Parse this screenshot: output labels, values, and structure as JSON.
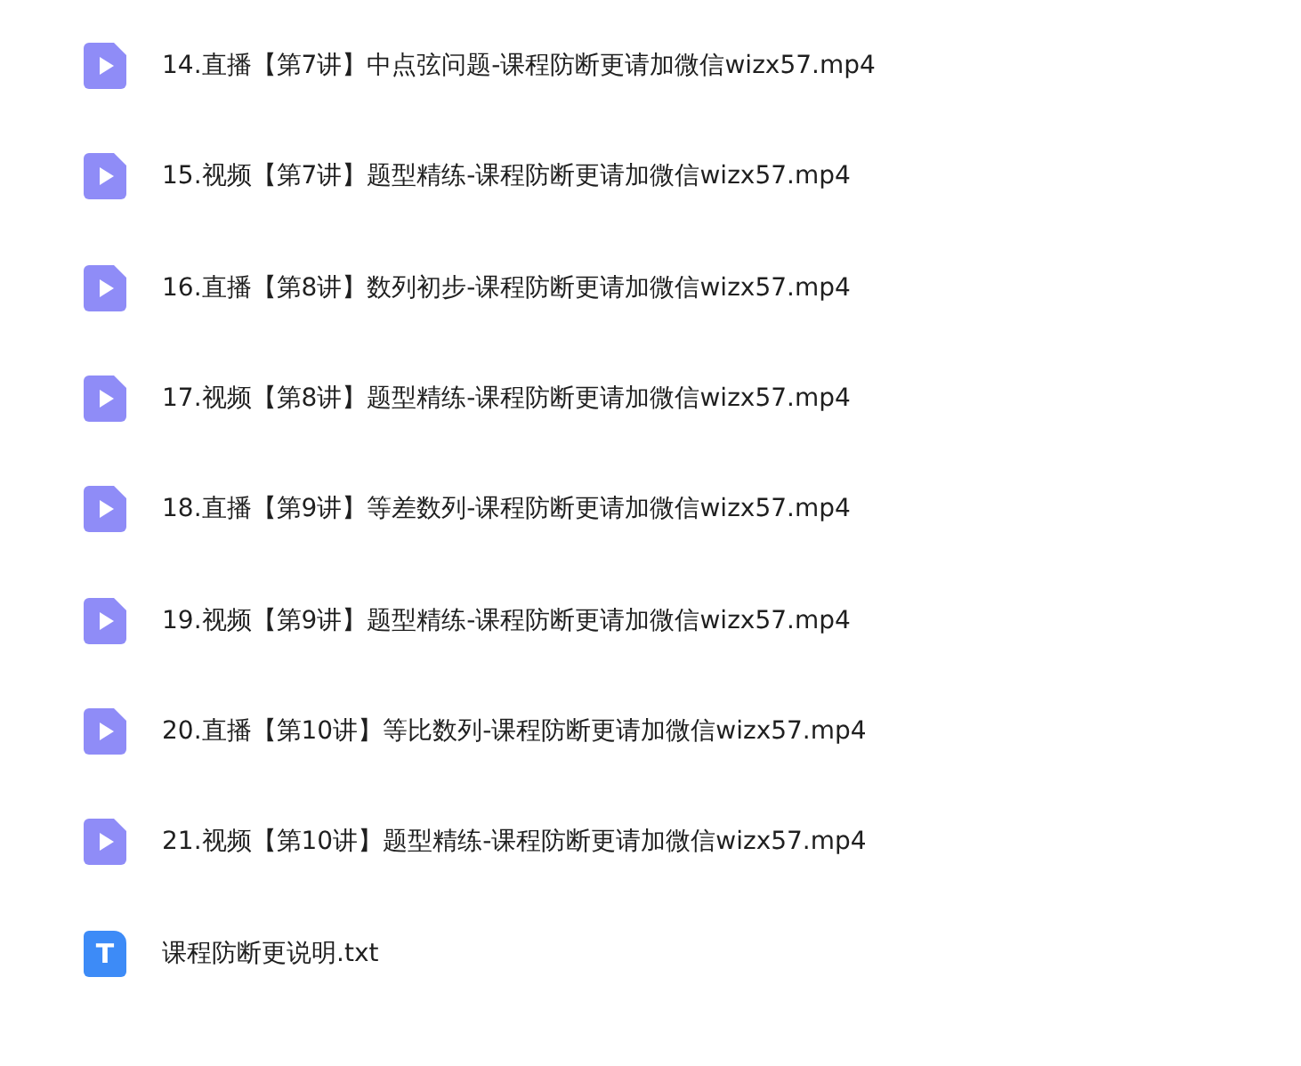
{
  "files": [
    {
      "kind": "video",
      "name": "14.直播【第7讲】中点弦问题-课程防断更请加微信wizx57.mp4"
    },
    {
      "kind": "video",
      "name": "15.视频【第7讲】题型精练-课程防断更请加微信wizx57.mp4"
    },
    {
      "kind": "video",
      "name": "16.直播【第8讲】数列初步-课程防断更请加微信wizx57.mp4"
    },
    {
      "kind": "video",
      "name": "17.视频【第8讲】题型精练-课程防断更请加微信wizx57.mp4"
    },
    {
      "kind": "video",
      "name": "18.直播【第9讲】等差数列-课程防断更请加微信wizx57.mp4"
    },
    {
      "kind": "video",
      "name": "19.视频【第9讲】题型精练-课程防断更请加微信wizx57.mp4"
    },
    {
      "kind": "video",
      "name": "20.直播【第10讲】等比数列-课程防断更请加微信wizx57.mp4"
    },
    {
      "kind": "video",
      "name": "21.视频【第10讲】题型精练-课程防断更请加微信wizx57.mp4"
    },
    {
      "kind": "text",
      "name": "课程防断更说明.txt",
      "icon_label": "T"
    }
  ]
}
